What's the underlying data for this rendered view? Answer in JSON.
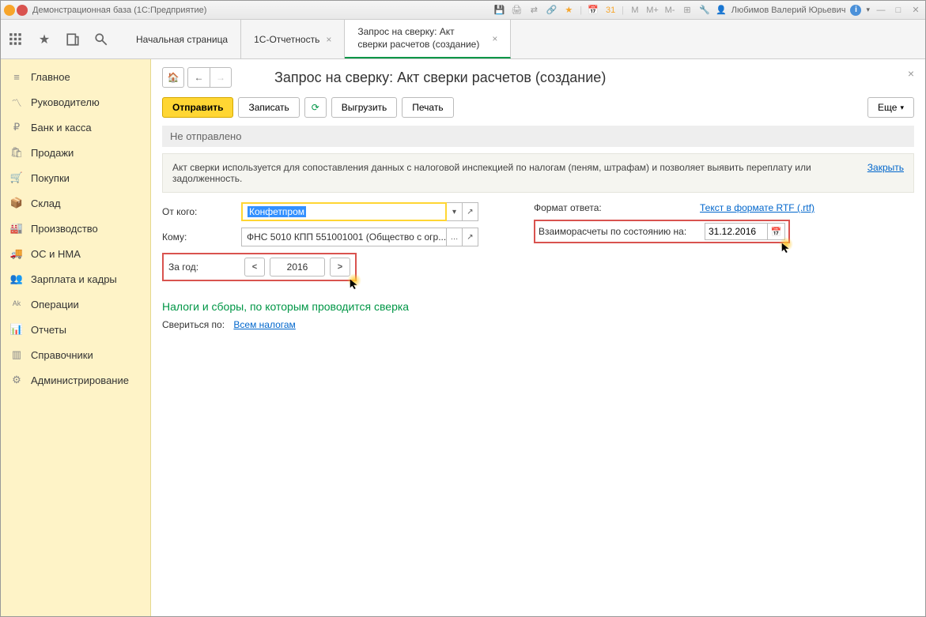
{
  "titlebar": {
    "title": "Демонстрационная база  (1С:Предприятие)",
    "user": "Любимов Валерий Юрьевич",
    "letters": [
      "M",
      "M+",
      "M-"
    ]
  },
  "tabs": {
    "items": [
      {
        "label": "Начальная страница",
        "closable": false
      },
      {
        "label": "1С-Отчетность",
        "closable": true
      },
      {
        "label": "Запрос на сверку: Акт сверки расчетов (создание)",
        "closable": true,
        "active": true
      }
    ]
  },
  "sidebar": {
    "items": [
      {
        "label": "Главное",
        "icon": "menu"
      },
      {
        "label": "Руководителю",
        "icon": "chart"
      },
      {
        "label": "Банк и касса",
        "icon": "ruble"
      },
      {
        "label": "Продажи",
        "icon": "bag"
      },
      {
        "label": "Покупки",
        "icon": "cart"
      },
      {
        "label": "Склад",
        "icon": "box"
      },
      {
        "label": "Производство",
        "icon": "factory"
      },
      {
        "label": "ОС и НМА",
        "icon": "truck"
      },
      {
        "label": "Зарплата и кадры",
        "icon": "people"
      },
      {
        "label": "Операции",
        "icon": "ops"
      },
      {
        "label": "Отчеты",
        "icon": "report"
      },
      {
        "label": "Справочники",
        "icon": "book"
      },
      {
        "label": "Администрирование",
        "icon": "gear"
      }
    ]
  },
  "page": {
    "title": "Запрос на сверку: Акт сверки расчетов (создание)",
    "toolbar": {
      "send": "Отправить",
      "save": "Записать",
      "export": "Выгрузить",
      "print": "Печать",
      "more": "Еще"
    },
    "status": "Не отправлено",
    "info": {
      "text": "Акт сверки используется для сопоставления данных с налоговой инспекцией по налогам (пеням, штрафам) и позволяет выявить переплату или задолженность.",
      "close": "Закрыть"
    },
    "form": {
      "from_label": "От кого:",
      "from_value": "Конфетпром",
      "to_label": "Кому:",
      "to_value": "ФНС 5010 КПП 551001001 (Общество с огр...",
      "year_label": "За год:",
      "year_value": "2016",
      "format_label": "Формат ответа:",
      "format_link": "Текст в формате RTF (.rtf)",
      "asof_label": "Взаиморасчеты по состоянию на:",
      "asof_value": "31.12.2016"
    },
    "section": {
      "title": "Налоги и сборы, по которым проводится сверка",
      "check_label": "Свериться по:",
      "check_link": "Всем налогам"
    }
  }
}
